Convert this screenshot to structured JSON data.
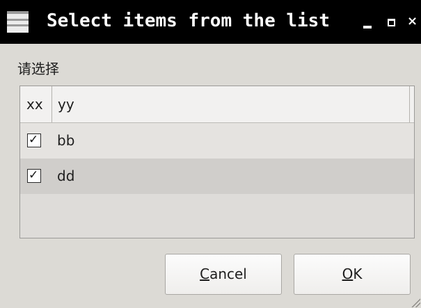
{
  "window": {
    "title": "Select items from the list",
    "controls": {
      "minimize_icon": "minimize-icon",
      "maximize_icon": "maximize-icon",
      "close_icon": "close-icon",
      "close_glyph": "×"
    }
  },
  "prompt": "请选择",
  "list": {
    "columns": [
      "xx",
      "yy"
    ],
    "rows": [
      {
        "checked": true,
        "value": "bb"
      },
      {
        "checked": true,
        "value": "dd"
      }
    ]
  },
  "buttons": {
    "cancel": {
      "mnemonic": "C",
      "rest": "ancel"
    },
    "ok": {
      "mnemonic": "O",
      "rest": "K"
    }
  },
  "colors": {
    "titlebar": "#000000",
    "dialog_bg": "#dcdad5",
    "header_bg": "#f2f1f0",
    "row_even": "#e5e3e0",
    "row_odd": "#d0cecb"
  }
}
